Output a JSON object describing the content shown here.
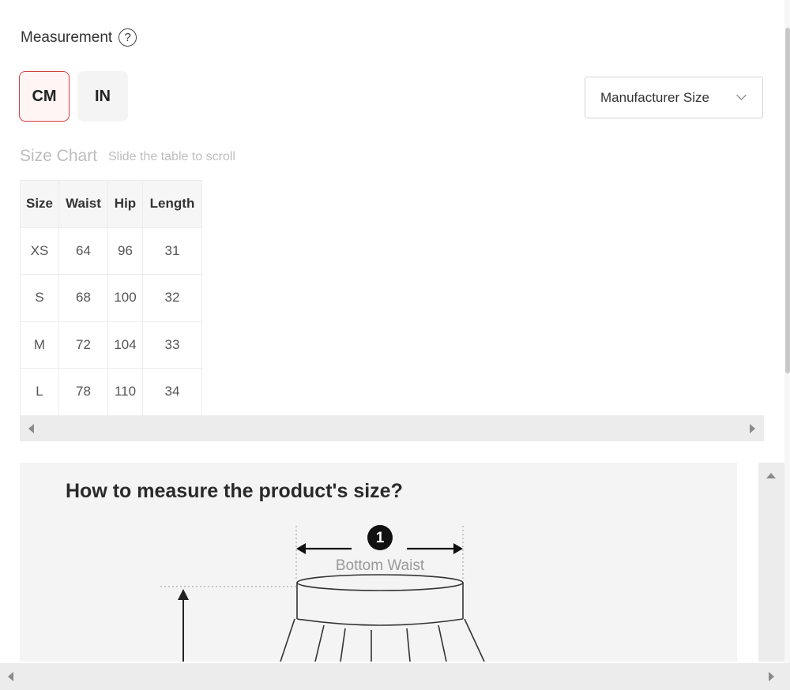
{
  "measurement": {
    "title": "Measurement",
    "help_icon": "?"
  },
  "units": {
    "cm": "CM",
    "in": "IN",
    "selected": "CM",
    "accent": "#d23f3f"
  },
  "size_select": {
    "value": "Manufacturer Size"
  },
  "size_chart": {
    "label": "Size Chart",
    "hint": "Slide the table to scroll",
    "headers": [
      "Size",
      "Waist",
      "Hip",
      "Length"
    ],
    "rows": [
      [
        "XS",
        "64",
        "96",
        "31"
      ],
      [
        "S",
        "68",
        "100",
        "32"
      ],
      [
        "M",
        "72",
        "104",
        "33"
      ],
      [
        "L",
        "78",
        "110",
        "34"
      ]
    ]
  },
  "guide": {
    "heading": "How to measure the product's size?",
    "step_number": "1",
    "step_label": "Bottom Waist"
  }
}
